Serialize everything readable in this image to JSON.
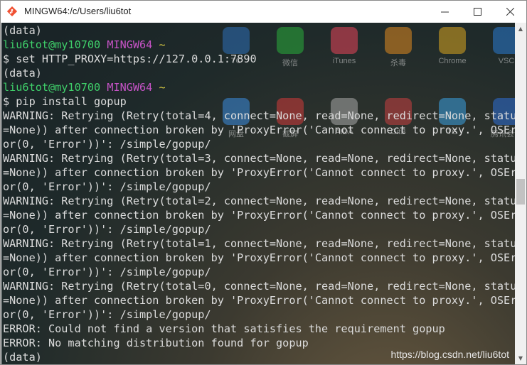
{
  "window": {
    "title": "MINGW64:/c/Users/liu6tot",
    "minimize": "—",
    "maximize": "☐",
    "close": "✕"
  },
  "desktop_icons": [
    {
      "label": "TC",
      "color": "#2d6fb8"
    },
    {
      "label": "微信",
      "color": "#2aae3b"
    },
    {
      "label": "iTunes",
      "color": "#e8445a"
    },
    {
      "label": "杀毒",
      "color": "#e08a20"
    },
    {
      "label": "Chrome",
      "color": "#d9a520"
    },
    {
      "label": "VSC",
      "color": "#2a7ad0"
    },
    {
      "label": "网盘",
      "color": "#3b8de0"
    },
    {
      "label": "截屏",
      "color": "#d23a3a"
    },
    {
      "label": "AIDA",
      "color": "#a9a9a9"
    },
    {
      "label": "GitB",
      "color": "#c94040"
    },
    {
      "label": "TG",
      "color": "#3aa0e0"
    },
    {
      "label": "腾讯会议",
      "color": "#2e6fd6"
    }
  ],
  "terminal": {
    "lines": [
      {
        "type": "text",
        "text": "(data)"
      },
      {
        "type": "prompt",
        "user": "liu6tot@my10700",
        "host": "MINGW64",
        "path": "~"
      },
      {
        "type": "text",
        "text": "$ set HTTP_PROXY=https://127.0.0.1:7890"
      },
      {
        "type": "text",
        "text": "(data)"
      },
      {
        "type": "prompt",
        "user": "liu6tot@my10700",
        "host": "MINGW64",
        "path": "~"
      },
      {
        "type": "text",
        "text": "$ pip install gopup"
      },
      {
        "type": "text",
        "text": "WARNING: Retrying (Retry(total=4, connect=None, read=None, redirect=None, status"
      },
      {
        "type": "text",
        "text": "=None)) after connection broken by 'ProxyError('Cannot connect to proxy.', OSErr"
      },
      {
        "type": "text",
        "text": "or(0, 'Error'))': /simple/gopup/"
      },
      {
        "type": "text",
        "text": "WARNING: Retrying (Retry(total=3, connect=None, read=None, redirect=None, status"
      },
      {
        "type": "text",
        "text": "=None)) after connection broken by 'ProxyError('Cannot connect to proxy.', OSErr"
      },
      {
        "type": "text",
        "text": "or(0, 'Error'))': /simple/gopup/"
      },
      {
        "type": "text",
        "text": "WARNING: Retrying (Retry(total=2, connect=None, read=None, redirect=None, status"
      },
      {
        "type": "text",
        "text": "=None)) after connection broken by 'ProxyError('Cannot connect to proxy.', OSErr"
      },
      {
        "type": "text",
        "text": "or(0, 'Error'))': /simple/gopup/"
      },
      {
        "type": "text",
        "text": "WARNING: Retrying (Retry(total=1, connect=None, read=None, redirect=None, status"
      },
      {
        "type": "text",
        "text": "=None)) after connection broken by 'ProxyError('Cannot connect to proxy.', OSErr"
      },
      {
        "type": "text",
        "text": "or(0, 'Error'))': /simple/gopup/"
      },
      {
        "type": "text",
        "text": "WARNING: Retrying (Retry(total=0, connect=None, read=None, redirect=None, status"
      },
      {
        "type": "text",
        "text": "=None)) after connection broken by 'ProxyError('Cannot connect to proxy.', OSErr"
      },
      {
        "type": "text",
        "text": "or(0, 'Error'))': /simple/gopup/"
      },
      {
        "type": "text",
        "text": "ERROR: Could not find a version that satisfies the requirement gopup"
      },
      {
        "type": "text",
        "text": "ERROR: No matching distribution found for gopup"
      },
      {
        "type": "text",
        "text": "(data)"
      }
    ]
  },
  "watermark": "https://blog.csdn.net/liu6tot",
  "colors": {
    "user": "#3fd06a",
    "host": "#c653c6",
    "path": "#d4c843",
    "text": "#dcdcdc"
  }
}
